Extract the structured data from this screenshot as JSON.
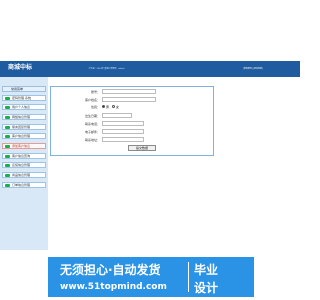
{
  "header": {
    "logo": "商城中标",
    "center_text": "·今天是：2024年 星期X 管理员：admin",
    "right_text": "[修改密码]  [退出系统]"
  },
  "sidebar": {
    "title": "常用菜单",
    "items": [
      {
        "label": "密码管理  系统"
      },
      {
        "label": "用户个人信息"
      },
      {
        "label": "网络信息管理"
      },
      {
        "label": "留言回复管理"
      },
      {
        "label": "客户信息管理"
      },
      {
        "label": "添加客户信息"
      },
      {
        "label": "客户信息查询"
      },
      {
        "label": "反馈信息管理"
      },
      {
        "label": "商品信息管理"
      },
      {
        "label": "订单信息管理"
      }
    ]
  },
  "form": {
    "fields": [
      {
        "label": "账号："
      },
      {
        "label": "客户姓名："
      },
      {
        "label": "性别："
      },
      {
        "label": "出生日期："
      },
      {
        "label": "联系电话："
      },
      {
        "label": "电子邮件："
      },
      {
        "label": "联系地址："
      }
    ],
    "gender_options": [
      "男",
      "女"
    ],
    "submit_label": "提交数据"
  },
  "banner": {
    "line1": "无须担心·自动发货",
    "line2": "www.51topmind.com",
    "right1": "毕业",
    "right2": "设计"
  },
  "colors": {
    "header": "#1f5b9f",
    "sidebar_bg": "#d9e8f7",
    "icon": "#19b04a",
    "banner": "#2b93e6"
  }
}
